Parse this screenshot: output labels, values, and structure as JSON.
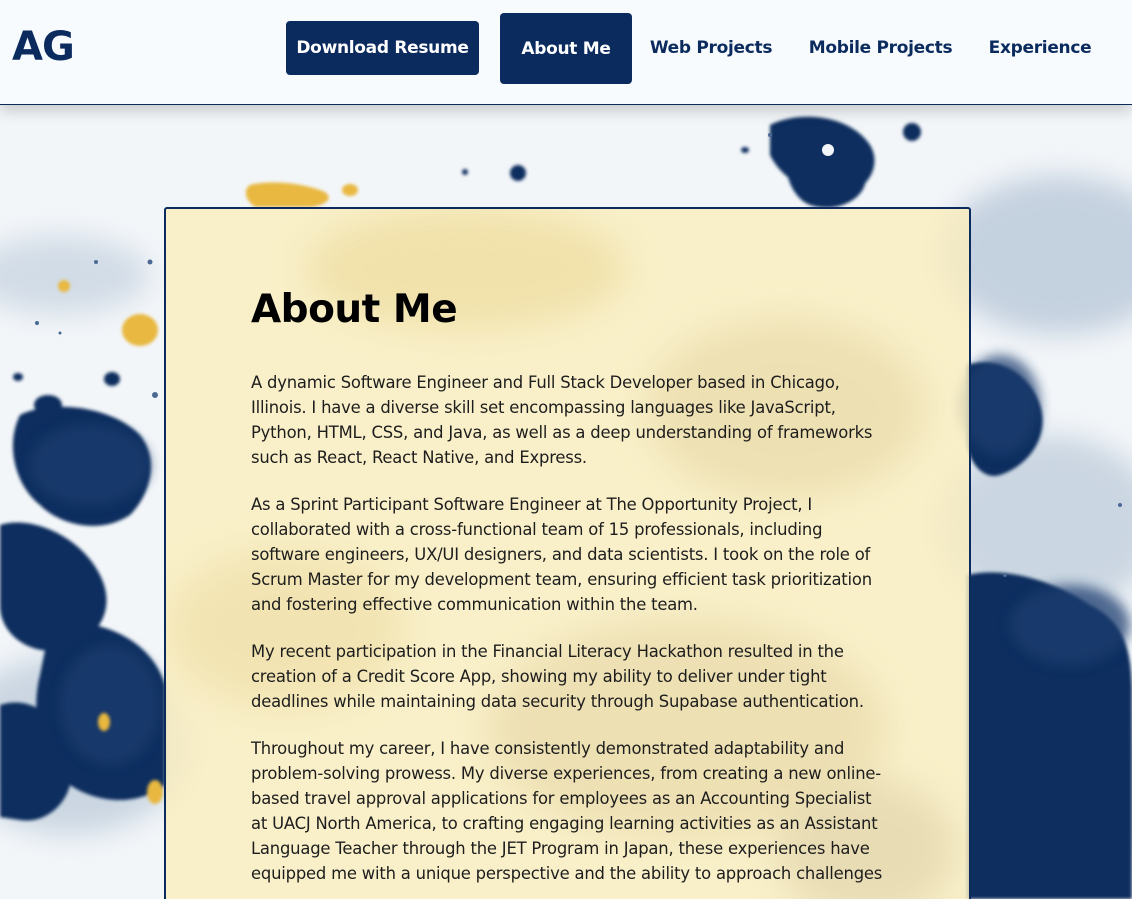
{
  "header": {
    "logo": "AG",
    "nav": {
      "download_resume": "Download Resume",
      "about_me": "About Me",
      "web_projects": "Web Projects",
      "mobile_projects": "Mobile Projects",
      "experience": "Experience"
    }
  },
  "about": {
    "title": "About Me",
    "paragraphs": [
      "A dynamic Software Engineer and Full Stack Developer based in Chicago, Illinois. I have a diverse skill set encompassing languages like JavaScript, Python, HTML, CSS, and Java, as well as a deep understanding of frameworks such as React, React Native, and Express.",
      "As a Sprint Participant Software Engineer at The Opportunity Project, I collaborated with a cross-functional team of 15 professionals, including software engineers, UX/UI designers, and data scientists. I took on the role of Scrum Master for my development team, ensuring efficient task prioritization and fostering effective communication within the team.",
      "My recent participation in the Financial Literacy Hackathon resulted in the creation of a Credit Score App, showing my ability to deliver under tight deadlines while maintaining data security through Supabase authentication.",
      "Throughout my career, I have consistently demonstrated adaptability and problem-solving prowess. My diverse experiences, from creating a new online-based travel approval applications for employees as an Accounting Specialist at UACJ North America, to crafting engaging learning activities as an Assistant Language Teacher through the JET Program in Japan, these experiences have equipped me with a unique perspective and the ability to approach challenges"
    ]
  },
  "colors": {
    "navy": "#0b2a5e",
    "cream_card": "#faeebe",
    "gold_ink": "#e8b840"
  }
}
